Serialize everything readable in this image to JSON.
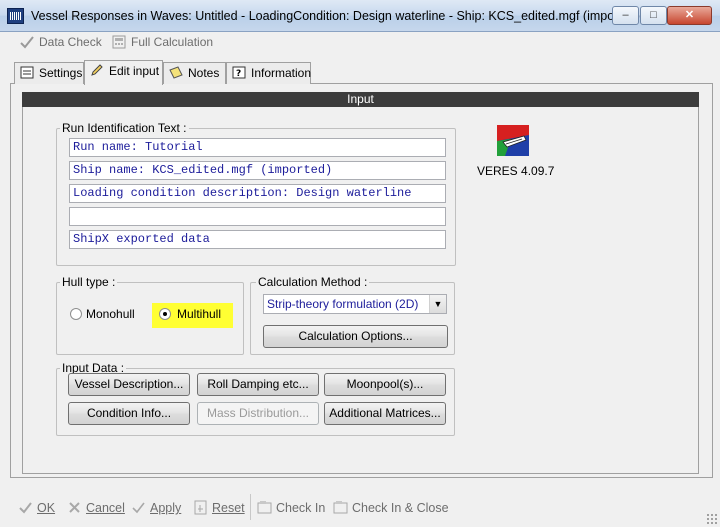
{
  "window": {
    "title": "Vessel Responses in Waves: Untitled - LoadingCondition: Design waterline - Ship: KCS_edited.mgf (imported)",
    "controls": {
      "minimize": "–",
      "maximize": "□",
      "close": "✕"
    }
  },
  "toolbar": {
    "data_check": "Data Check",
    "full_calculation": "Full Calculation"
  },
  "tabs": [
    {
      "label": "Settings",
      "icon": "settings-icon"
    },
    {
      "label": "Edit input",
      "icon": "pencil-icon",
      "active": true
    },
    {
      "label": "Notes",
      "icon": "notes-icon"
    },
    {
      "label": "Information",
      "icon": "question-icon"
    }
  ],
  "panel": {
    "header": "Input",
    "run_identification": {
      "legend": "Run Identification Text :",
      "lines": [
        "Run name: Tutorial",
        "Ship name: KCS_edited.mgf (imported)",
        "Loading condition description: Design waterline",
        "",
        "ShipX exported data"
      ]
    },
    "logo": {
      "version": "VERES 4.09.7"
    },
    "hull_type": {
      "legend": "Hull type :",
      "monohull": "Monohull",
      "multihull": "Multihull",
      "selected": "Multihull",
      "highlight_color": "#ffff33"
    },
    "calc_method": {
      "legend": "Calculation Method :",
      "selected": "Strip-theory formulation (2D)",
      "options_button": "Calculation Options..."
    },
    "input_data": {
      "legend": "Input Data :",
      "buttons": [
        {
          "label": "Vessel Description...",
          "enabled": true
        },
        {
          "label": "Roll Damping etc...",
          "enabled": true
        },
        {
          "label": "Moonpool(s)...",
          "enabled": true
        },
        {
          "label": "Condition Info...",
          "enabled": true
        },
        {
          "label": "Mass Distribution...",
          "enabled": false
        },
        {
          "label": "Additional Matrices...",
          "enabled": true
        }
      ]
    }
  },
  "bottom_bar": {
    "ok": "OK",
    "cancel": "Cancel",
    "apply": "Apply",
    "reset": "Reset",
    "check_in": "Check In",
    "check_in_close": "Check In & Close"
  },
  "colors": {
    "text_field_color": "#1c1c9a",
    "header_bg": "#3c3c3c"
  }
}
